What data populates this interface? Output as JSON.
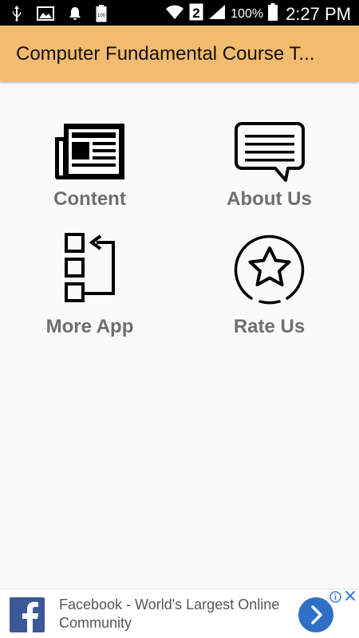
{
  "status_bar": {
    "battery_percent": "100%",
    "time": "2:27 PM",
    "sim_slot": "2",
    "icons": [
      "usb-icon",
      "image-icon",
      "notification-bell-icon",
      "battery-saver-icon",
      "wifi-icon",
      "sim-icon",
      "signal-icon",
      "battery-icon"
    ]
  },
  "app_bar": {
    "title": "Computer Fundamental Course T..."
  },
  "menu": {
    "items": [
      {
        "label": "Content",
        "icon": "newspaper-icon"
      },
      {
        "label": "About Us",
        "icon": "chat-bubble-icon"
      },
      {
        "label": "More App",
        "icon": "apps-list-icon"
      },
      {
        "label": "Rate Us",
        "icon": "star-circle-icon"
      }
    ]
  },
  "ad": {
    "text": "Facebook - World's Largest Online Community",
    "icons": [
      "facebook-logo-icon",
      "arrow-right-icon",
      "info-icon",
      "close-icon"
    ],
    "colors": {
      "facebook": "#3b5998",
      "arrow": "#2f6fc5"
    }
  },
  "colors": {
    "app_bar": "#f3bb6f",
    "label": "#6e6e6e",
    "background": "#fafafa"
  }
}
